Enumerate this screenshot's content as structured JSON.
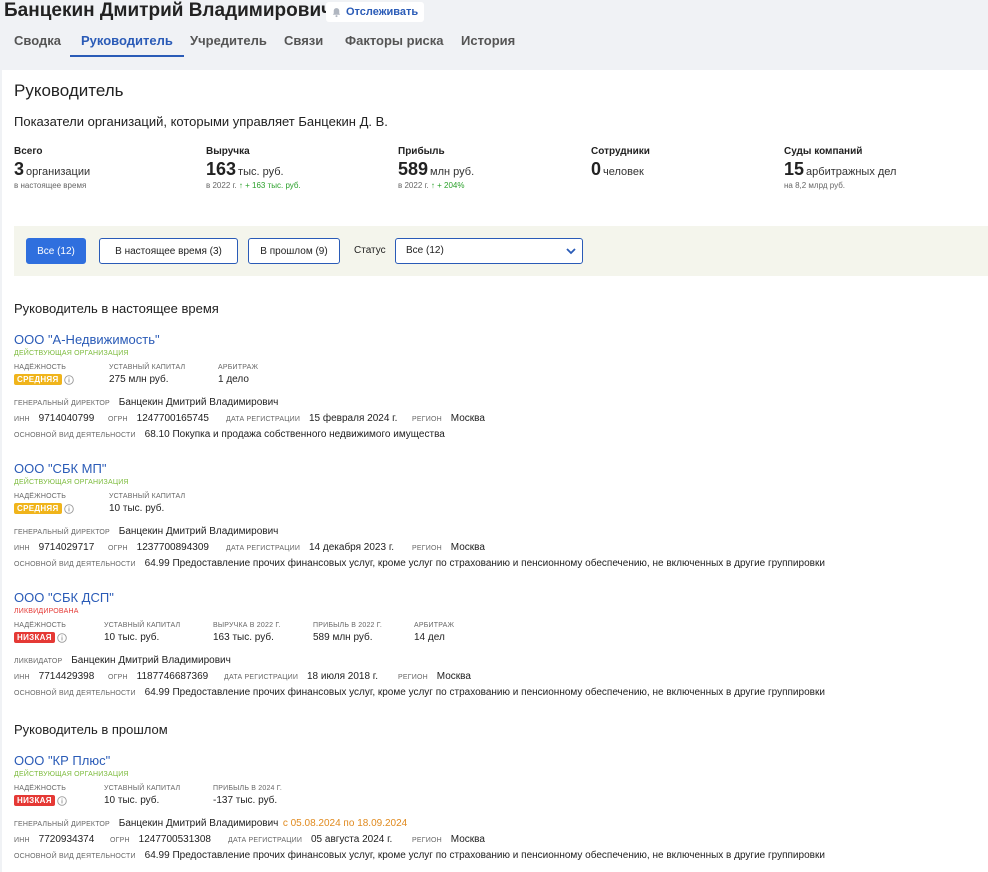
{
  "header": {
    "person_name": "Банцекин Дмитрий Владимирович",
    "follow_label": "Отслеживать",
    "tabs": [
      {
        "label": "Сводка"
      },
      {
        "label": "Руководитель",
        "active": true
      },
      {
        "label": "Учредитель"
      },
      {
        "label": "Связи"
      },
      {
        "label": "Факторы риска"
      },
      {
        "label": "История"
      }
    ]
  },
  "main": {
    "title": "Руководитель",
    "subtitle": "Показатели организаций, которыми управляет Банцекин Д. В.",
    "stats": [
      {
        "label": "Всего",
        "number": "3",
        "unit": "организации",
        "note": "в настоящее время",
        "growth": ""
      },
      {
        "label": "Выручка",
        "number": "163",
        "unit": "тыс. руб.",
        "note": "в 2022 г.",
        "growth": "↑ + 163 тыс. руб."
      },
      {
        "label": "Прибыль",
        "number": "589",
        "unit": "млн руб.",
        "note": "в 2022 г.",
        "growth": "↑ + 204%"
      },
      {
        "label": "Сотрудники",
        "number": "0",
        "unit": "человек",
        "note": "",
        "growth": ""
      },
      {
        "label": "Суды компаний",
        "number": "15",
        "unit": "арбитражных дел",
        "note": "на 8,2 млрд руб.",
        "growth": ""
      }
    ],
    "filters": {
      "all": "Все (12)",
      "current": "В настоящее время (3)",
      "past": "В прошлом (9)",
      "status_label": "Статус",
      "status_value": "Все (12)"
    },
    "current_section_title": "Руководитель в настоящее время",
    "past_section_title": "Руководитель в прошлом",
    "labels": {
      "reliability": "НАДЁЖНОСТЬ",
      "capital": "УСТАВНЫЙ КАПИТАЛ",
      "arbitration": "АРБИТРАЖ",
      "revenue_2022": "ВЫРУЧКА В 2022 Г.",
      "profit_2022": "ПРИБЫЛЬ В 2022 Г.",
      "profit_2024": "ПРИБЫЛЬ В 2024 Г.",
      "gen_director": "ГЕНЕРАЛЬНЫЙ ДИРЕКТОР",
      "liquidator": "ЛИКВИДАТОР",
      "inn": "ИНН",
      "ogrn": "ОГРН",
      "reg_date": "ДАТА РЕГИСТРАЦИИ",
      "region": "РЕГИОН",
      "activity": "ОСНОВНОЙ ВИД ДЕЯТЕЛЬНОСТИ"
    },
    "orgs": [
      {
        "name": "ООО \"А-Недвижимость\"",
        "status": "ДЕЙСТВУЮЩАЯ ОРГАНИЗАЦИЯ",
        "reliability": "СРЕДНЯЯ",
        "capital": "275 млн руб.",
        "arbitration": "1 дело",
        "director": "Банцекин Дмитрий Владимирович",
        "inn": "9714040799",
        "ogrn": "1247700165745",
        "reg_date": "15 февраля 2024 г.",
        "region": "Москва",
        "activity": "68.10 Покупка и продажа собственного недвижимого имущества"
      },
      {
        "name": "ООО \"СБК МП\"",
        "status": "ДЕЙСТВУЮЩАЯ ОРГАНИЗАЦИЯ",
        "reliability": "СРЕДНЯЯ",
        "capital": "10 тыс. руб.",
        "director": "Банцекин Дмитрий Владимирович",
        "inn": "9714029717",
        "ogrn": "1237700894309",
        "reg_date": "14 декабря 2023 г.",
        "region": "Москва",
        "activity": "64.99 Предоставление прочих финансовых услуг, кроме услуг по страхованию и пенсионному обеспечению, не включенных в другие группировки"
      },
      {
        "name": "ООО \"СБК ДСП\"",
        "status": "ЛИКВИДИРОВАНА",
        "reliability": "НИЗКАЯ",
        "capital": "10 тыс. руб.",
        "revenue": "163 тыс. руб.",
        "profit": "589 млн руб.",
        "arbitration": "14 дел",
        "director": "Банцекин Дмитрий Владимирович",
        "inn": "7714429398",
        "ogrn": "1187746687369",
        "reg_date": "18 июля 2018 г.",
        "region": "Москва",
        "activity": "64.99 Предоставление прочих финансовых услуг, кроме услуг по страхованию и пенсионному обеспечению, не включенных в другие группировки"
      },
      {
        "name": "ООО \"КР Плюс\"",
        "status": "ДЕЙСТВУЮЩАЯ ОРГАНИЗАЦИЯ",
        "reliability": "НИЗКАЯ",
        "capital": "10 тыс. руб.",
        "profit": "-137 тыс. руб.",
        "director": "Банцекин Дмитрий Владимирович",
        "director_period": "с 05.08.2024 по 18.09.2024",
        "inn": "7720934374",
        "ogrn": "1247700531308",
        "reg_date": "05 августа 2024 г.",
        "region": "Москва",
        "activity": "64.99 Предоставление прочих финансовых услуг, кроме услуг по страхованию и пенсионному обеспечению, не включенных в другие группировки"
      }
    ]
  },
  "colors": {
    "accent": "#2a5bb7",
    "active_button": "#2f6fde",
    "status_active": "#7cbb3c",
    "status_liquidated": "#e53935",
    "badge_medium": "#f0b41b",
    "badge_low": "#e53935",
    "growth": "#2aa02a",
    "date_range": "#e08a1e"
  },
  "icons": {
    "follow": "bell-icon",
    "info": "info-icon",
    "select": "chevron-down-icon"
  }
}
